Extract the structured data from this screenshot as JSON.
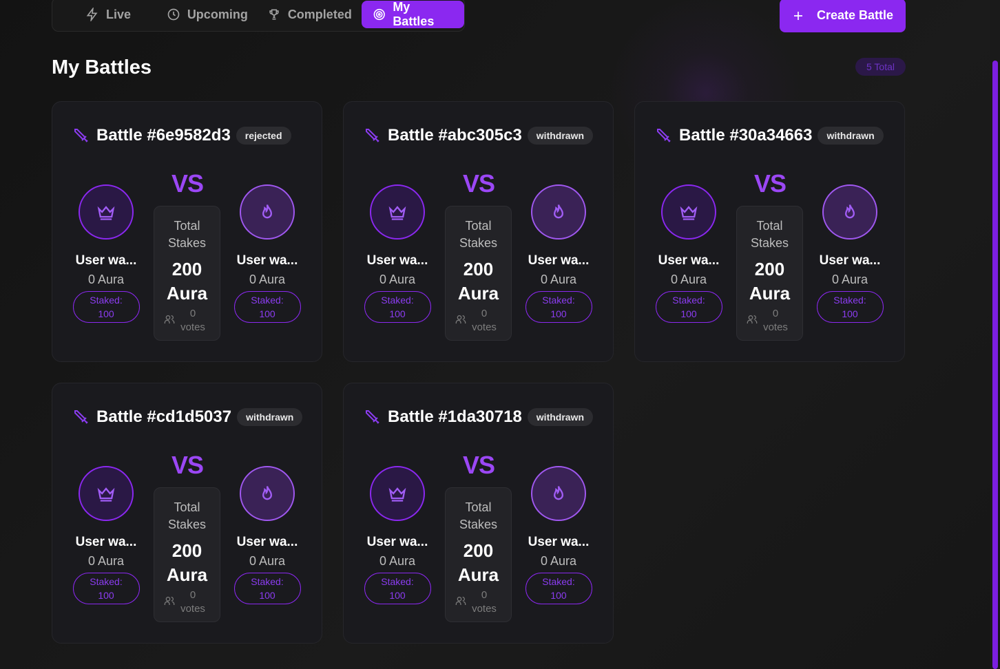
{
  "tabs": [
    {
      "label": "Live",
      "icon": "bolt-icon",
      "active": false
    },
    {
      "label": "Upcoming",
      "icon": "clock-icon",
      "active": false
    },
    {
      "label": "Completed",
      "icon": "trophy-icon",
      "active": false
    },
    {
      "label": "My Battles",
      "icon": "target-icon",
      "active": true
    }
  ],
  "create_button": {
    "label": "Create Battle",
    "icon": "plus-icon"
  },
  "page": {
    "title": "My Battles",
    "total_badge": "5 Total"
  },
  "colors": {
    "accent": "#8b28f0",
    "vs": "#9b47f5",
    "background": "#151515",
    "card": "#1a1a1e"
  },
  "battles": [
    {
      "name": "Battle #6e9582d3",
      "status": "rejected",
      "vs": "VS",
      "left": {
        "name": "User wa...",
        "aura": "0 Aura",
        "staked_label": "Staked:",
        "staked_value": "100"
      },
      "right": {
        "name": "User wa...",
        "aura": "0 Aura",
        "staked_label": "Staked:",
        "staked_value": "100"
      },
      "total_label": "Total Stakes",
      "total_value": "200 Aura",
      "votes_count": "0",
      "votes_label": "votes"
    },
    {
      "name": "Battle #abc305c3",
      "status": "withdrawn",
      "vs": "VS",
      "left": {
        "name": "User wa...",
        "aura": "0 Aura",
        "staked_label": "Staked:",
        "staked_value": "100"
      },
      "right": {
        "name": "User wa...",
        "aura": "0 Aura",
        "staked_label": "Staked:",
        "staked_value": "100"
      },
      "total_label": "Total Stakes",
      "total_value": "200 Aura",
      "votes_count": "0",
      "votes_label": "votes"
    },
    {
      "name": "Battle #30a34663",
      "status": "withdrawn",
      "vs": "VS",
      "left": {
        "name": "User wa...",
        "aura": "0 Aura",
        "staked_label": "Staked:",
        "staked_value": "100"
      },
      "right": {
        "name": "User wa...",
        "aura": "0 Aura",
        "staked_label": "Staked:",
        "staked_value": "100"
      },
      "total_label": "Total Stakes",
      "total_value": "200 Aura",
      "votes_count": "0",
      "votes_label": "votes"
    },
    {
      "name": "Battle #cd1d5037",
      "status": "withdrawn",
      "vs": "VS",
      "left": {
        "name": "User wa...",
        "aura": "0 Aura",
        "staked_label": "Staked:",
        "staked_value": "100"
      },
      "right": {
        "name": "User wa...",
        "aura": "0 Aura",
        "staked_label": "Staked:",
        "staked_value": "100"
      },
      "total_label": "Total Stakes",
      "total_value": "200 Aura",
      "votes_count": "0",
      "votes_label": "votes"
    },
    {
      "name": "Battle #1da30718",
      "status": "withdrawn",
      "vs": "VS",
      "left": {
        "name": "User wa...",
        "aura": "0 Aura",
        "staked_label": "Staked:",
        "staked_value": "100"
      },
      "right": {
        "name": "User wa...",
        "aura": "0 Aura",
        "staked_label": "Staked:",
        "staked_value": "100"
      },
      "total_label": "Total Stakes",
      "total_value": "200 Aura",
      "votes_count": "0",
      "votes_label": "votes"
    }
  ]
}
